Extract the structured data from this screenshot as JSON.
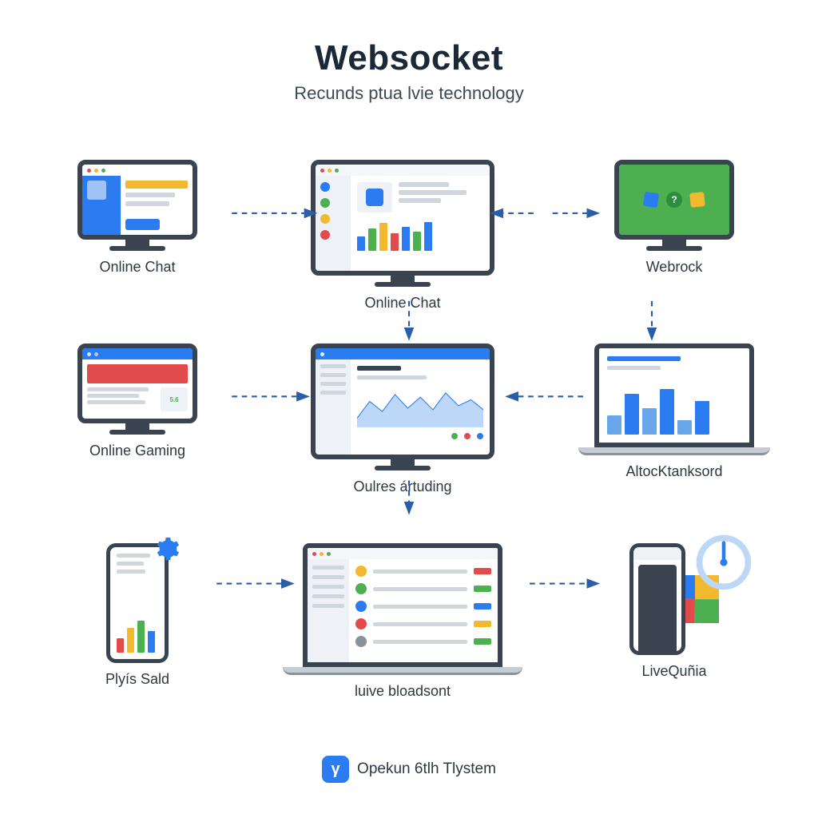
{
  "colors": {
    "accent": "#2b7cf1",
    "dark": "#1b2838",
    "green": "#4caf50",
    "red": "#e24b4b",
    "yellow": "#f2b82e",
    "gray": "#cfd6dd"
  },
  "header": {
    "title": "Websocket",
    "subtitle": "Recunds ptua lvie technology"
  },
  "cells": {
    "r1c1": "Online Chat",
    "r1c2": "Online Chat",
    "r1c3": "Webrock",
    "r2c1": "Online Gaming",
    "r2c2": "Oulres ártuding",
    "r2c3": "AltocKtanksord",
    "r3c1": "Plyís Sald",
    "r3c2": "luive bloadsont",
    "r3c3": "LiveQuñia"
  },
  "footer": {
    "logo_glyph": "γ",
    "text": "Opekun 6tlh Tlystem"
  }
}
